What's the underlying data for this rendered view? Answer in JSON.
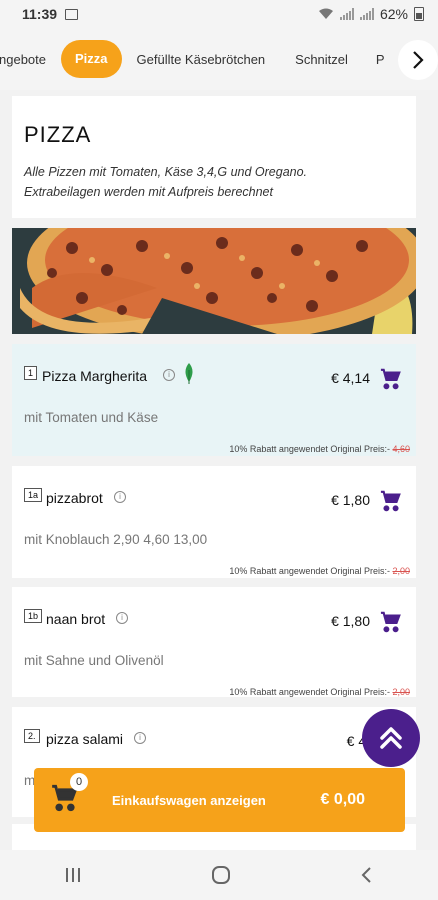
{
  "status_bar": {
    "time": "11:39",
    "battery": "62%"
  },
  "tabs": [
    {
      "label": "ngebote",
      "active": false
    },
    {
      "label": "Pizza",
      "active": true
    },
    {
      "label": "Gefüllte Käsebrötchen",
      "active": false
    },
    {
      "label": "Schnitzel",
      "active": false
    },
    {
      "label": "P",
      "active": false
    }
  ],
  "section": {
    "title": "PIZZA",
    "description_line1": "Alle Pizzen mit Tomaten, Käse 3,4,G und Oregano.",
    "description_line2": "Extrabeilagen werden mit Aufpreis berechnet"
  },
  "items": [
    {
      "number": "1",
      "name": "Pizza Margherita",
      "price": "€ 4,14",
      "description": "mit Tomaten und Käse",
      "discount_text": "10% Rabatt angewendet Original Preis:-",
      "original_price": "4,60",
      "vegetarian": true,
      "highlighted": true
    },
    {
      "number": "1a",
      "name": "pizzabrot",
      "price": "€ 1,80",
      "description": "mit Knoblauch 2,90 4,60 13,00",
      "discount_text": "10% Rabatt angewendet Original Preis:-",
      "original_price": "2,00"
    },
    {
      "number": "1b",
      "name": "naan brot",
      "price": "€ 1,80",
      "description": "mit Sahne und Olivenöl",
      "discount_text": "10% Rabatt angewendet Original Preis:-",
      "original_price": "2,00"
    },
    {
      "number": "2.",
      "name": "pizza salami",
      "price": "€ 4,",
      "description": "m"
    }
  ],
  "cart": {
    "count": "0",
    "label": "Einkaufswagen anzeigen",
    "total": "€ 0,00"
  },
  "colors": {
    "accent": "#f6a21a",
    "primary": "#4b1f8c",
    "strike": "#d9534f",
    "highlight": "#e8f4f6",
    "veg": "#2e9d4a"
  }
}
